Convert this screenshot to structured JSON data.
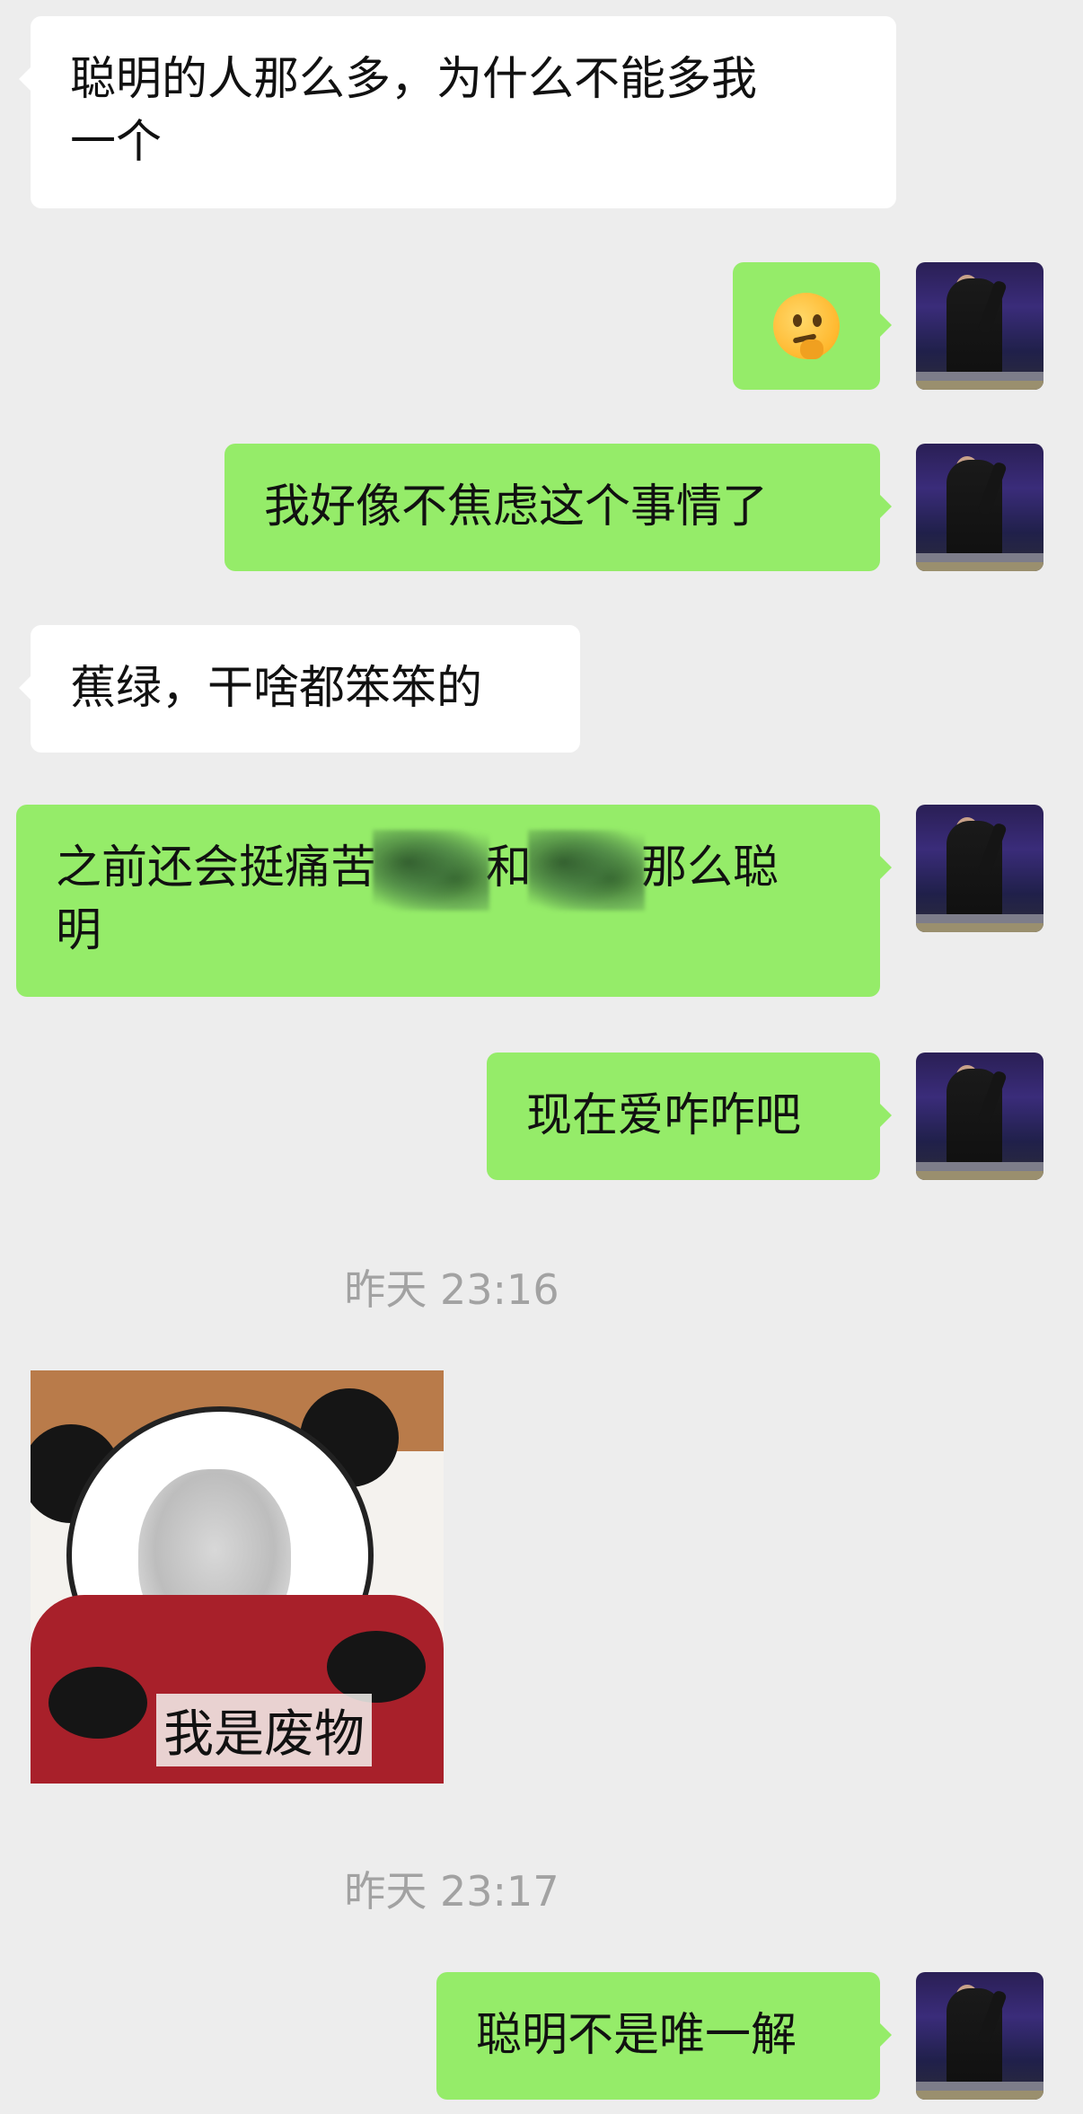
{
  "messages": [
    {
      "id": "m1",
      "direction": "in",
      "type": "text",
      "lines": [
        "聪明的人那么多，为什么不能多我",
        "一个"
      ]
    },
    {
      "id": "m2",
      "direction": "out",
      "type": "emoji",
      "icon": "thinking-face-emoji"
    },
    {
      "id": "m3",
      "direction": "out",
      "type": "text",
      "lines": [
        "我好像不焦虑这个事情了"
      ]
    },
    {
      "id": "m4",
      "direction": "in",
      "type": "text",
      "lines": [
        "蕉绿，干啥都笨笨的"
      ]
    },
    {
      "id": "m5",
      "direction": "out",
      "type": "text",
      "parts": [
        "之前还会挺痛苦",
        "和",
        "那么聪"
      ],
      "line2": "明"
    },
    {
      "id": "m6",
      "direction": "out",
      "type": "text",
      "lines": [
        "现在爱咋咋吧"
      ]
    },
    {
      "id": "m8",
      "direction": "in",
      "type": "sticker",
      "caption": "我是废物"
    },
    {
      "id": "m10",
      "direction": "out",
      "type": "text",
      "lines": [
        "聪明不是唯一解"
      ]
    }
  ],
  "timestamps": [
    "昨天 23:16",
    "昨天 23:17"
  ],
  "colors": {
    "background": "#ededed",
    "incoming_bubble": "#ffffff",
    "outgoing_bubble": "#95ec69",
    "timestamp": "#a2a2a2"
  }
}
